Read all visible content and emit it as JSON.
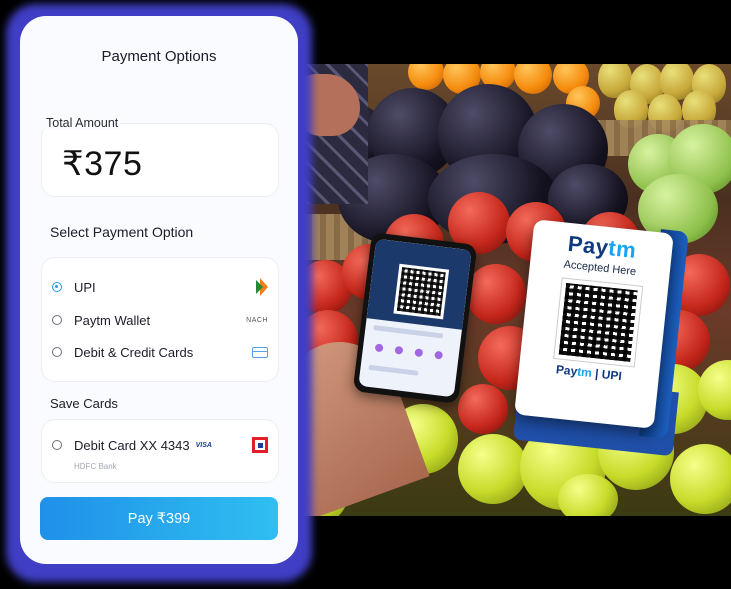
{
  "payment_card": {
    "title": "Payment Options",
    "total_amount_label": "Total Amount",
    "total_amount_value": "₹375",
    "select_option_title": "Select Payment Option",
    "options": [
      {
        "label": "UPI",
        "selected": true,
        "icon": "upi-icon"
      },
      {
        "label": "Paytm Wallet",
        "selected": false,
        "icon": "nach-icon",
        "icon_text": "NACH"
      },
      {
        "label": "Debit & Credit Cards",
        "selected": false,
        "icon": "card-icon"
      }
    ],
    "save_cards_title": "Save Cards",
    "saved_card": {
      "label": "Debit Card XX 4343",
      "network": "VISA",
      "bank": "HDFC Bank",
      "icon": "hdfc-bank-icon",
      "selected": false
    },
    "pay_button": "Pay ₹399"
  },
  "photo": {
    "stand_brand_pay": "Pay",
    "stand_brand_tm": "tm",
    "stand_accepted": "Accepted Here",
    "stand_footer_pay": "Pay",
    "stand_footer_tm": "tm",
    "stand_footer_upi": "UPI"
  },
  "colors": {
    "accent": "#1f90e9",
    "glow": "#3f3ec4",
    "paytm_navy": "#0f3a7f",
    "paytm_cyan": "#1aa4ef"
  }
}
